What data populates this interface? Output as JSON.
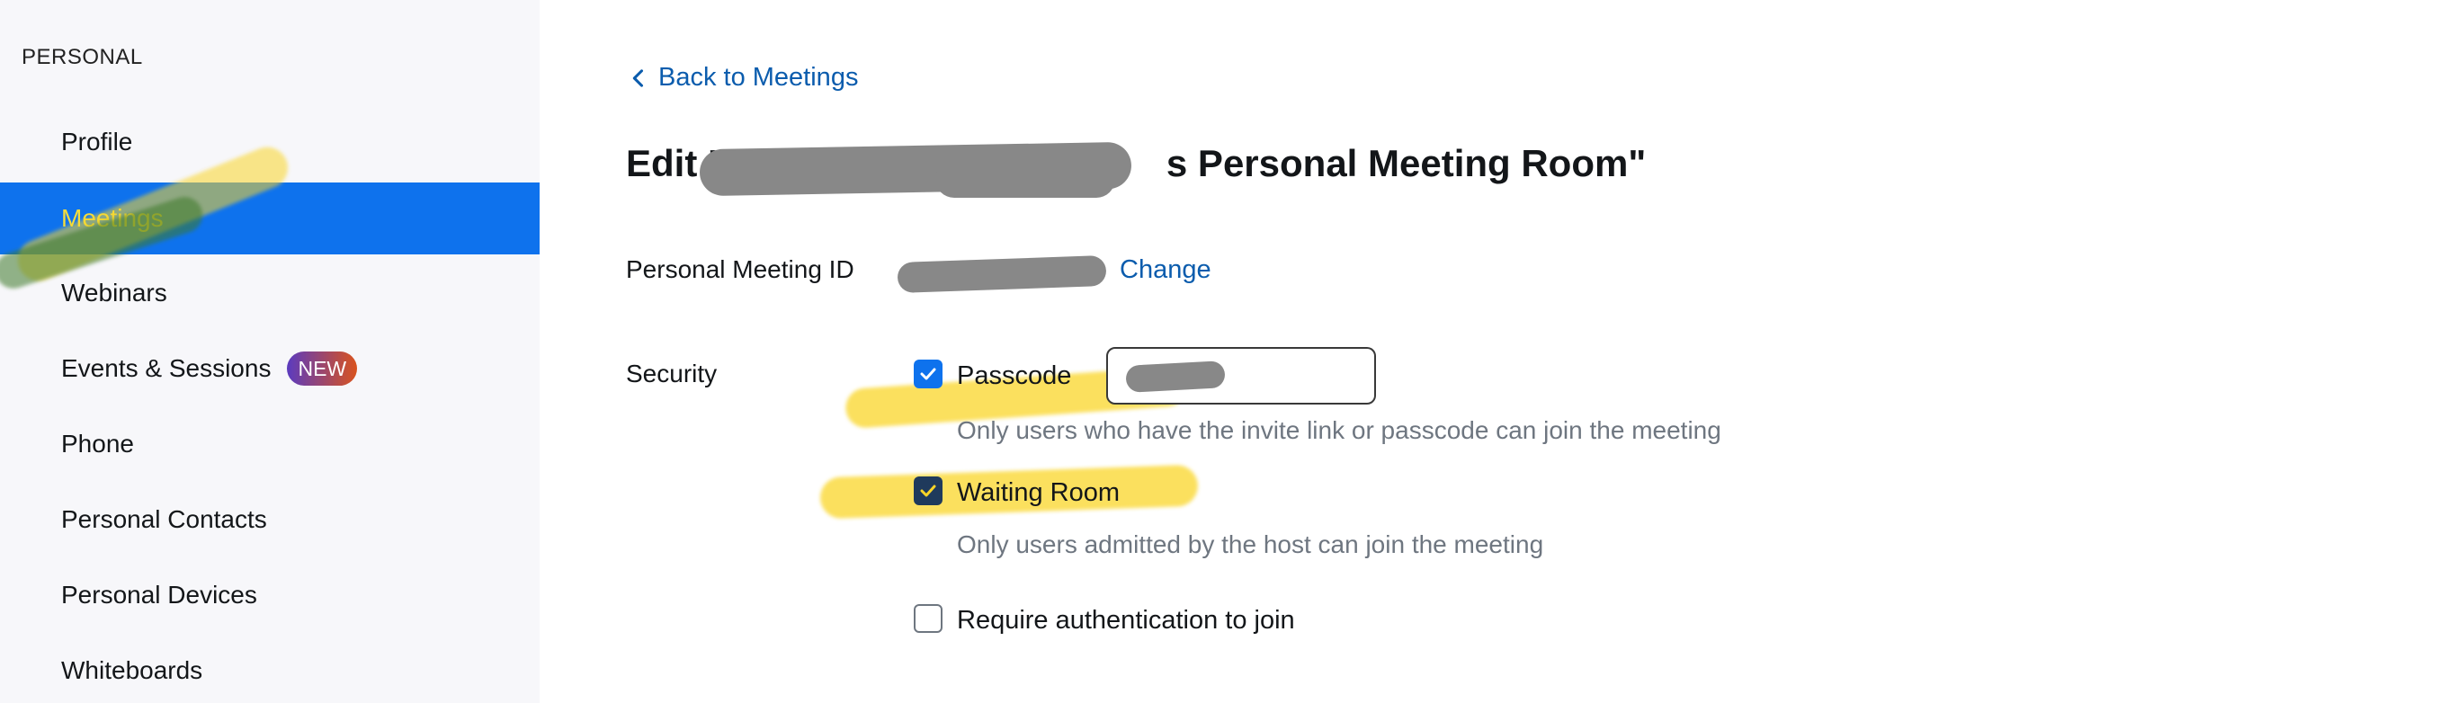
{
  "sidebar": {
    "section_title": "PERSONAL",
    "items": [
      {
        "label": "Profile"
      },
      {
        "label": "Meetings",
        "active": true
      },
      {
        "label": "Webinars"
      },
      {
        "label": "Events & Sessions",
        "badge": "NEW"
      },
      {
        "label": "Phone"
      },
      {
        "label": "Personal Contacts"
      },
      {
        "label": "Personal Devices"
      },
      {
        "label": "Whiteboards"
      }
    ]
  },
  "main": {
    "back_link": "Back to Meetings",
    "title_prefix": "Edit \"",
    "title_suffix": "s Personal Meeting Room\"",
    "pmi": {
      "label": "Personal Meeting ID",
      "value": "",
      "change_label": "Change"
    },
    "security": {
      "label": "Security",
      "passcode": {
        "label": "Passcode",
        "checked": true,
        "value": "",
        "description": "Only users who have the invite link or passcode can join the meeting"
      },
      "waiting_room": {
        "label": "Waiting Room",
        "checked": true,
        "description": "Only users admitted by the host can join the meeting"
      },
      "require_auth": {
        "label": "Require authentication to join",
        "checked": false
      }
    }
  },
  "colors": {
    "accent": "#0e72ed",
    "link": "#0b5cad",
    "highlighter": "#fad528",
    "sidebar_bg": "#f7f7fa"
  }
}
